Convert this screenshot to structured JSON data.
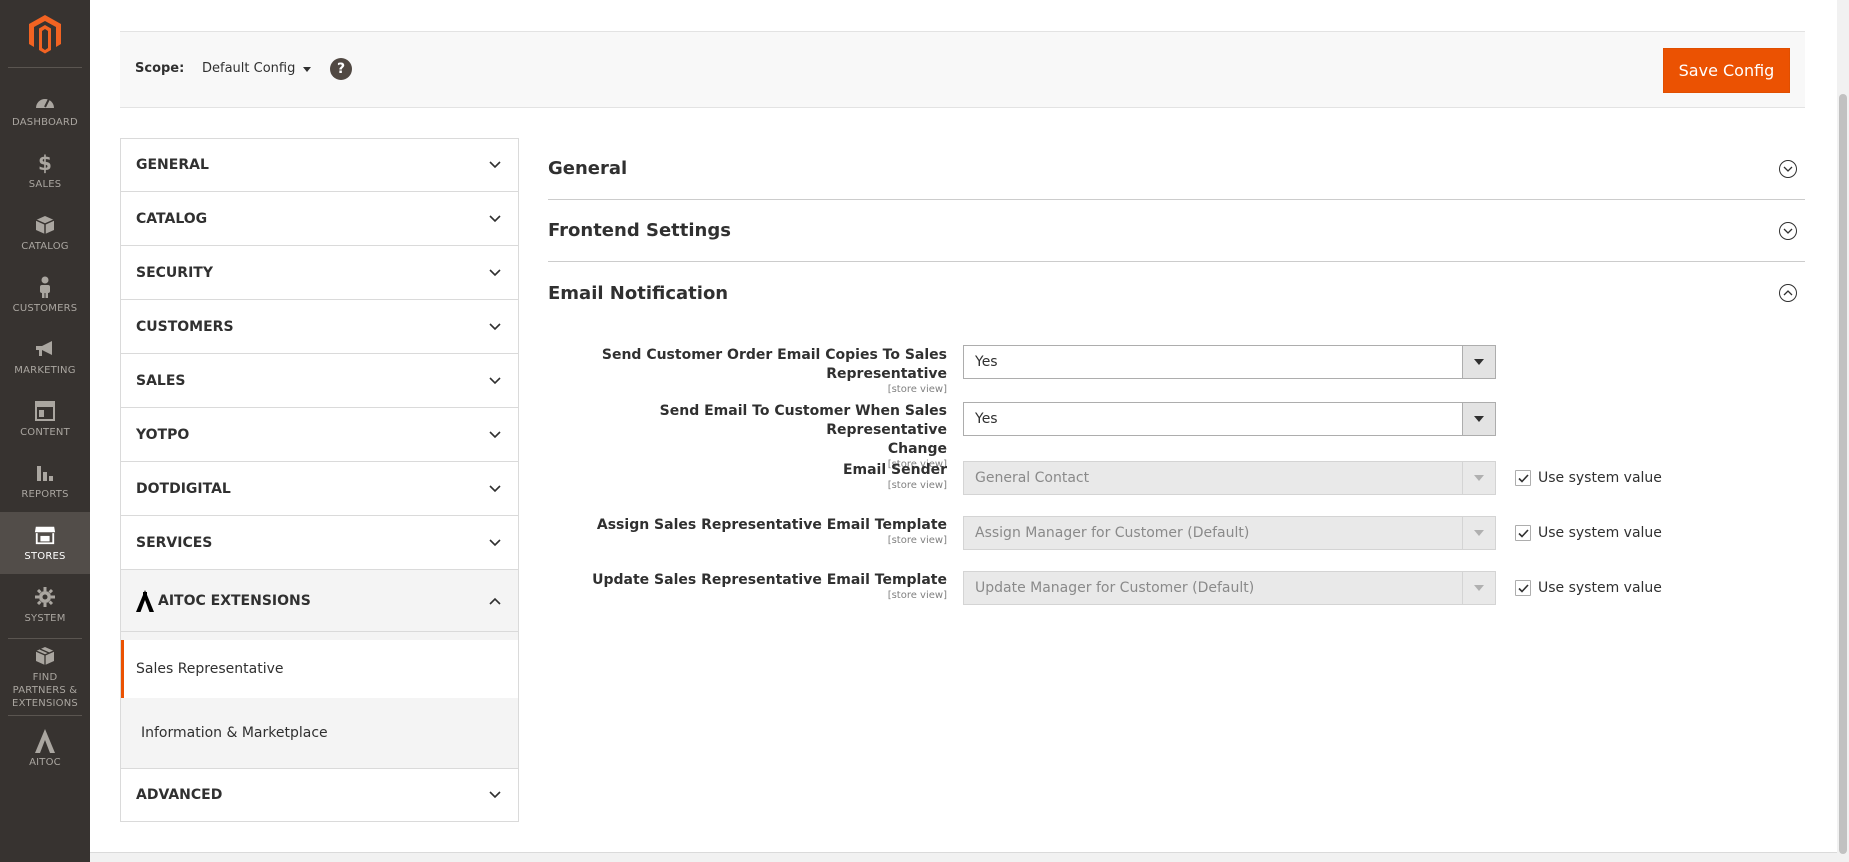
{
  "nav": {
    "items": [
      {
        "label": "DASHBOARD",
        "icon": "dashboard-icon"
      },
      {
        "label": "SALES",
        "icon": "dollar-icon"
      },
      {
        "label": "CATALOG",
        "icon": "box-icon"
      },
      {
        "label": "CUSTOMERS",
        "icon": "person-icon"
      },
      {
        "label": "MARKETING",
        "icon": "megaphone-icon"
      },
      {
        "label": "CONTENT",
        "icon": "content-icon"
      },
      {
        "label": "REPORTS",
        "icon": "bar-chart-icon"
      },
      {
        "label": "STORES",
        "icon": "store-icon"
      },
      {
        "label": "SYSTEM",
        "icon": "gear-icon"
      },
      {
        "label": "FIND PARTNERS & EXTENSIONS",
        "icon": "extensions-icon"
      },
      {
        "label": "AITOC",
        "icon": "aitoc-icon"
      }
    ]
  },
  "scope": {
    "label": "Scope:",
    "value": "Default Config",
    "help": "?"
  },
  "toolbar": {
    "save_label": "Save Config"
  },
  "tabs": [
    {
      "label": "GENERAL"
    },
    {
      "label": "CATALOG"
    },
    {
      "label": "SECURITY"
    },
    {
      "label": "CUSTOMERS"
    },
    {
      "label": "SALES"
    },
    {
      "label": "YOTPO"
    },
    {
      "label": "DOTDIGITAL"
    },
    {
      "label": "SERVICES"
    },
    {
      "label": "AITOC EXTENSIONS"
    },
    {
      "label": "ADVANCED"
    }
  ],
  "subitems": [
    {
      "label": "Sales Representative"
    },
    {
      "label": "Information & Marketplace"
    }
  ],
  "sections": [
    {
      "title": "General"
    },
    {
      "title": "Frontend Settings"
    },
    {
      "title": "Email Notification"
    }
  ],
  "fields": [
    {
      "label": "Send Customer Order Email Copies To Sales Representative",
      "scope": "[store view]",
      "value": "Yes"
    },
    {
      "label_line1": "Send Email To Customer When Sales Representative",
      "label_line2": "Change",
      "scope": "[store view]",
      "value": "Yes"
    },
    {
      "label": "Email Sender",
      "scope": "[store view]",
      "value": "General Contact",
      "use_system": "Use system value"
    },
    {
      "label": "Assign Sales Representative Email Template",
      "scope": "[store view]",
      "value": "Assign Manager for Customer (Default)",
      "use_system": "Use system value"
    },
    {
      "label": "Update Sales Representative Email Template",
      "scope": "[store view]",
      "value": "Update Manager for Customer (Default)",
      "use_system": "Use system value"
    }
  ],
  "colors": {
    "accent": "#eb5202",
    "nav_bg": "#373330"
  }
}
